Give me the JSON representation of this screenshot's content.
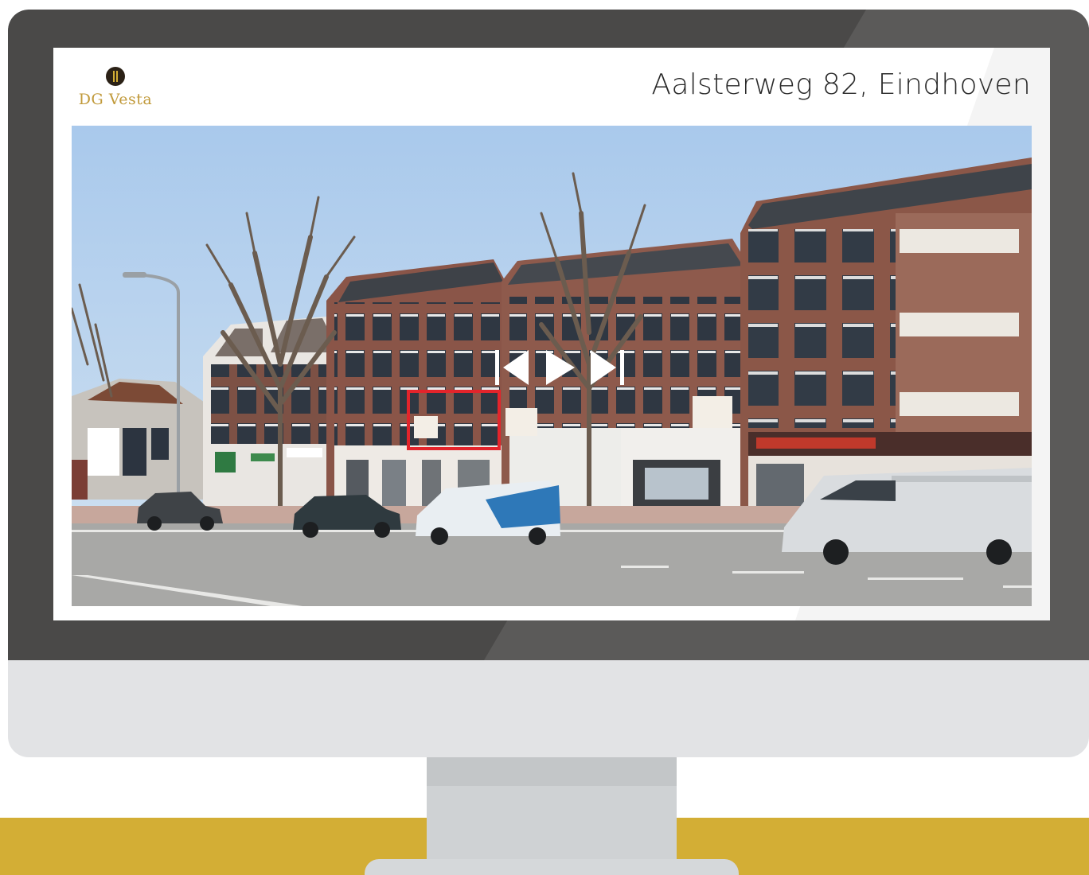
{
  "header": {
    "logo_text": "DG Vesta",
    "address": "Aalsterweg 82, Eindhoven"
  },
  "viewer": {
    "controls": {
      "previous_icon": "skip-back-icon",
      "play_icon": "play-icon",
      "next_icon": "skip-forward-icon",
      "color": "#ffffff"
    },
    "highlight_color": "#e3242b"
  },
  "colors": {
    "brand_gold": "#d3ae35",
    "bezel": "#4a4948",
    "monitor_body": "#e2e3e5"
  }
}
